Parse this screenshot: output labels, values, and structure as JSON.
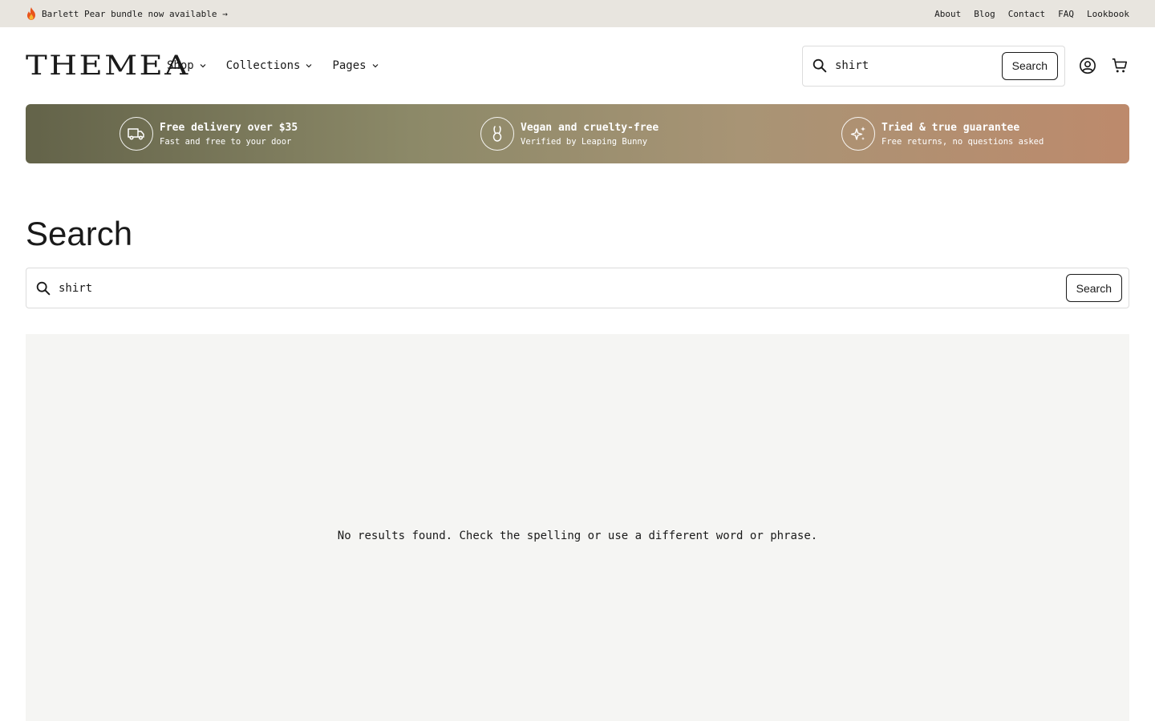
{
  "announcement": {
    "icon": "flame-icon",
    "text": "Barlett Pear bundle now available →",
    "links": [
      "About",
      "Blog",
      "Contact",
      "FAQ",
      "Lookbook"
    ]
  },
  "header": {
    "logo": "THEMEA",
    "nav": [
      {
        "label": "Shop",
        "icon": "chevron-down-icon"
      },
      {
        "label": "Collections",
        "icon": "chevron-down-icon"
      },
      {
        "label": "Pages",
        "icon": "chevron-down-icon"
      }
    ],
    "search": {
      "value": "shirt",
      "button_label": "Search"
    },
    "icons": [
      "account-icon",
      "cart-icon"
    ]
  },
  "banner": {
    "colors": [
      "#636349",
      "#bd8a6c"
    ],
    "features": [
      {
        "icon": "truck-icon",
        "title": "Free delivery over $35",
        "subtitle": "Fast and free to your door"
      },
      {
        "icon": "rabbit-icon",
        "title": "Vegan and cruelty-free",
        "subtitle": "Verified by Leaping Bunny"
      },
      {
        "icon": "sparkle-icon",
        "title": "Tried & true guarantee",
        "subtitle": "Free returns, no questions asked"
      }
    ]
  },
  "main": {
    "title": "Search",
    "search": {
      "value": "shirt",
      "button_label": "Search"
    },
    "empty_message": "No results found. Check the spelling or use a different word or phrase."
  }
}
